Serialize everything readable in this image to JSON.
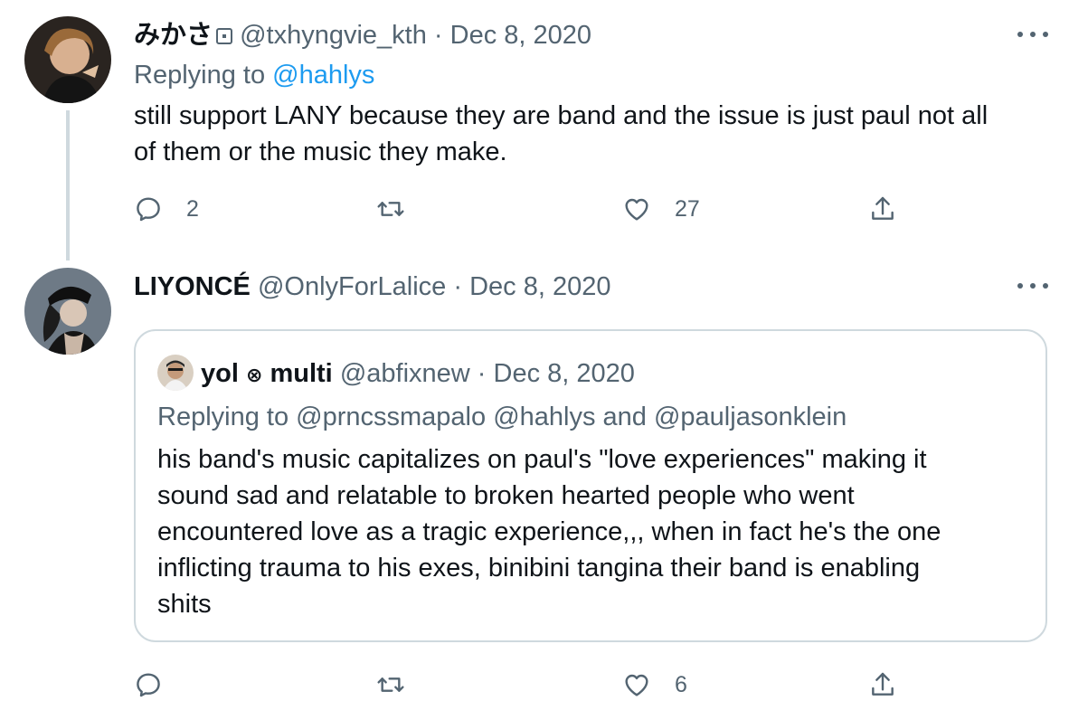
{
  "tweets": [
    {
      "display_name": "みかさ",
      "handle": "@txhyngvie_kth",
      "sep": "·",
      "date": "Dec 8, 2020",
      "replying_prefix": "Replying to",
      "replying_to": "@hahlys",
      "text_line1": "still support LANY because they are band and the issue is just paul not all",
      "text_line2": "of them or the music they make.",
      "stats": {
        "replies": "2",
        "retweets": "",
        "likes": "27"
      }
    },
    {
      "display_name": "LIYONCÉ",
      "handle": "@OnlyForLalice",
      "sep": "·",
      "date": "Dec 8, 2020",
      "stats": {
        "replies": "",
        "retweets": "",
        "likes": "6"
      }
    }
  ],
  "quote": {
    "display_name": "yol",
    "name_symbol": "⊗",
    "display_name_suffix": "multi",
    "handle": "@abfixnew",
    "sep": "·",
    "date": "Dec 8, 2020",
    "replying_prefix": "Replying to",
    "replying_to_1": "@prncssmapalo",
    "replying_to_2": "@hahlys",
    "replying_and": "and",
    "replying_to_3": "@pauljasonklein",
    "lines": [
      "his band's music capitalizes on paul's \"love experiences\" making it",
      "sound sad and relatable to broken hearted people who went",
      "encountered love as a tragic experience,,, when in fact he's the one",
      "inflicting trauma to his exes, binibini tangina their band is enabling",
      "shits"
    ]
  },
  "icons": {
    "reply": "reply-icon",
    "retweet": "retweet-icon",
    "like": "heart-icon",
    "share": "share-icon",
    "more": "more-icon"
  },
  "colors": {
    "link": "#1d9bf0",
    "muted": "#536471",
    "border": "#cfd9de"
  }
}
